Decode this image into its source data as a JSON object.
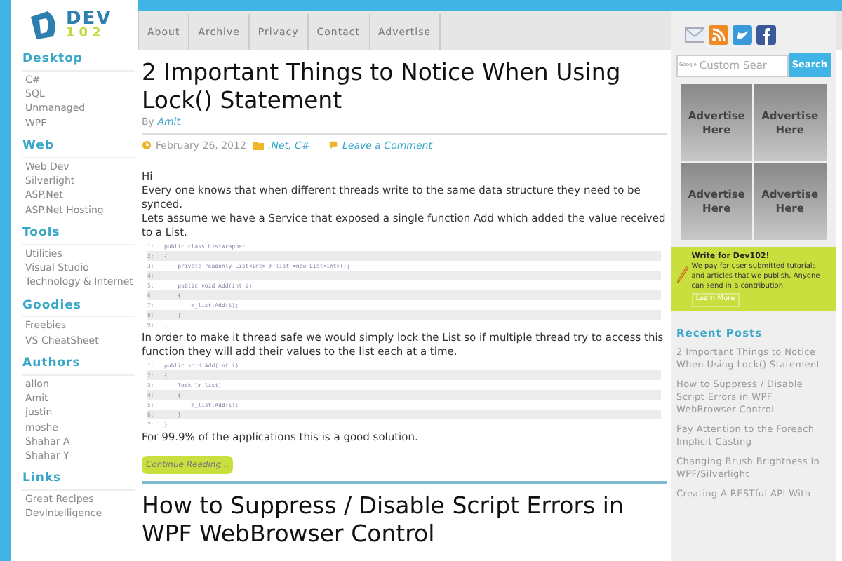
{
  "logo": {
    "line1": "DEV",
    "line2": "102"
  },
  "sidebar": [
    {
      "title": "Desktop",
      "items": [
        "C#",
        "SQL",
        "Unmanaged",
        "WPF"
      ]
    },
    {
      "title": "Web",
      "items": [
        "Web Dev",
        "Silverlight",
        "ASP.Net",
        "ASP.Net Hosting"
      ]
    },
    {
      "title": "Tools",
      "items": [
        "Utilities",
        "Visual Studio",
        "Technology & Internet"
      ]
    },
    {
      "title": "Goodies",
      "items": [
        "Freebies",
        "VS CheatSheet"
      ]
    },
    {
      "title": "Authors",
      "items": [
        "allon",
        "Amit",
        "justin",
        "moshe",
        "Shahar A",
        "Shahar Y"
      ]
    },
    {
      "title": "Links",
      "items": [
        "Great Recipes",
        "DevIntelligence"
      ]
    }
  ],
  "nav": [
    "About",
    "Archive",
    "Privacy",
    "Contact",
    "Advertise"
  ],
  "post": {
    "title": "2 Important Things to Notice When Using Lock() Statement",
    "by": "By",
    "author": "Amit",
    "date": "February 26, 2012",
    "categories": ".Net, C#",
    "comments": "Leave a Comment",
    "body": [
      {
        "kind": "text",
        "text": "Hi"
      },
      {
        "kind": "text",
        "text": "Every one knows that when different threads write to the same data structure they need to be synced."
      },
      {
        "kind": "text",
        "text": "Lets assume we have a Service that exposed a single function Add which added the value received to a List."
      },
      {
        "kind": "code",
        "lines": [
          {
            "num": "1:",
            "code": "public class ListWrapper"
          },
          {
            "num": "2:",
            "code": "{"
          },
          {
            "num": "3:",
            "code": "    private readonly List<int> m_list =new List<int>();"
          },
          {
            "num": "4:"
          },
          {
            "num": "5:",
            "code": "    public void Add(int i)"
          },
          {
            "num": "6:",
            "code": "    {"
          },
          {
            "num": "7:",
            "code": "        m_list.Add(i);"
          },
          {
            "num": "8:",
            "code": "    }"
          },
          {
            "num": "9:",
            "code": "}"
          }
        ]
      },
      {
        "kind": "text",
        "text": "In order to make it thread safe we would simply lock the List so if multiple thread try to access this function they will add their values to the list each at a time."
      },
      {
        "kind": "code",
        "lines": [
          {
            "num": "1:",
            "code": "public void Add(int i)"
          },
          {
            "num": "2:",
            "code": "{"
          },
          {
            "num": "3:",
            "code": "    lock (m_list)"
          },
          {
            "num": "4:",
            "code": "    {"
          },
          {
            "num": "5:",
            "code": "        m_list.Add(i);"
          },
          {
            "num": "6:",
            "code": "    }"
          },
          {
            "num": "7:",
            "code": "}"
          }
        ]
      },
      {
        "kind": "text",
        "text": "For 99.9% of the applications this is a good solution."
      }
    ],
    "more": "Continue Reading..."
  },
  "next_post": {
    "title": "How to Suppress / Disable Script Errors in WPF WebBrowser Control"
  },
  "search": {
    "brand": "Google",
    "placeholder": "Custom Sear",
    "button": "Search"
  },
  "ads": [
    "Advertise Here",
    "Advertise Here",
    "Advertise Here",
    "Advertise Here"
  ],
  "write": {
    "title": "Write for Dev102!",
    "text": "We pay for user submitted tutorials and articles that we publish. Anyone can send in a contribution",
    "button": "Learn More"
  },
  "recent": {
    "title": "Recent Posts",
    "items": [
      "2 Important Things to Notice When Using Lock() Statement",
      "How to Suppress / Disable Script Errors in WPF WebBrowser Control",
      "Pay Attention to the Foreach Implicit Casting",
      "Changing Brush Brightness in WPF/Silverlight",
      "Creating A RESTful API With"
    ]
  }
}
